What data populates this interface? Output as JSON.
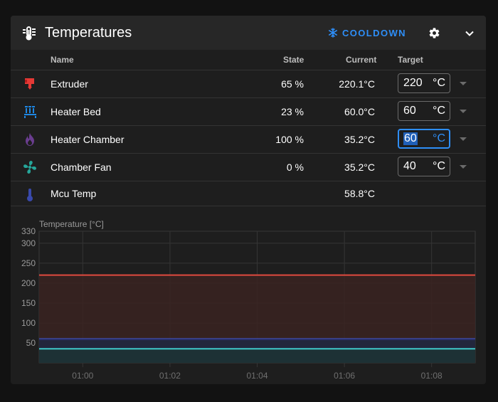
{
  "header": {
    "title": "Temperatures",
    "cooldown_label": "COOLDOWN"
  },
  "columns": {
    "name": "Name",
    "state": "State",
    "current": "Current",
    "target": "Target"
  },
  "rows": [
    {
      "name": "Extruder",
      "state": "65 %",
      "current": "220.1°C",
      "target": "220",
      "unit": "°C",
      "icon": "extruder-icon",
      "color": "#e53935"
    },
    {
      "name": "Heater Bed",
      "state": "23 %",
      "current": "60.0°C",
      "target": "60",
      "unit": "°C",
      "icon": "heater-bed-icon",
      "color": "#1e88e5"
    },
    {
      "name": "Heater Chamber",
      "state": "100 %",
      "current": "35.2°C",
      "target": "60",
      "unit": "°C",
      "icon": "fire-icon",
      "color": "#6a3d8f"
    },
    {
      "name": "Chamber Fan",
      "state": "0 %",
      "current": "35.2°C",
      "target": "40",
      "unit": "°C",
      "icon": "fan-icon",
      "color": "#26a69a"
    },
    {
      "name": "Mcu Temp",
      "state": "",
      "current": "58.8°C",
      "icon": "thermometer-icon",
      "color": "#3949ab"
    }
  ],
  "chart_data": {
    "type": "line",
    "ylabel": "Temperature [°C]",
    "xlabel": "",
    "ylim": [
      0,
      330
    ],
    "yticks": [
      50,
      100,
      150,
      200,
      250,
      300,
      330
    ],
    "xticks": [
      "01:00",
      "01:02",
      "01:04",
      "01:06",
      "01:08"
    ],
    "xtick_positions_min": [
      1,
      3,
      5,
      7,
      9
    ],
    "xlim_min": [
      0,
      10
    ],
    "grid": true,
    "series": [
      {
        "key": "extruder",
        "color": "#e04a3f",
        "fill": "#3a2321",
        "values": [
          220,
          220,
          220,
          220,
          220,
          220,
          220,
          220,
          220,
          220,
          220
        ]
      },
      {
        "key": "heater_bed",
        "color": "#4a5fd6",
        "fill": "#1e2742",
        "values": [
          60,
          60,
          60,
          60,
          60,
          60,
          60,
          60,
          60,
          60,
          60
        ]
      },
      {
        "key": "mcu",
        "color": "#2a3270",
        "fill": "",
        "values": [
          58.8,
          58.8,
          58.8,
          58.8,
          58.8,
          58.8,
          58.8,
          58.8,
          58.8,
          58.8,
          58.8
        ]
      },
      {
        "key": "chamber",
        "color": "#3fc9c9",
        "fill": "#1c3434",
        "values": [
          35.2,
          35.2,
          35.2,
          35.2,
          35.2,
          35.2,
          35.2,
          35.2,
          35.2,
          35.2,
          35.2
        ]
      }
    ]
  }
}
